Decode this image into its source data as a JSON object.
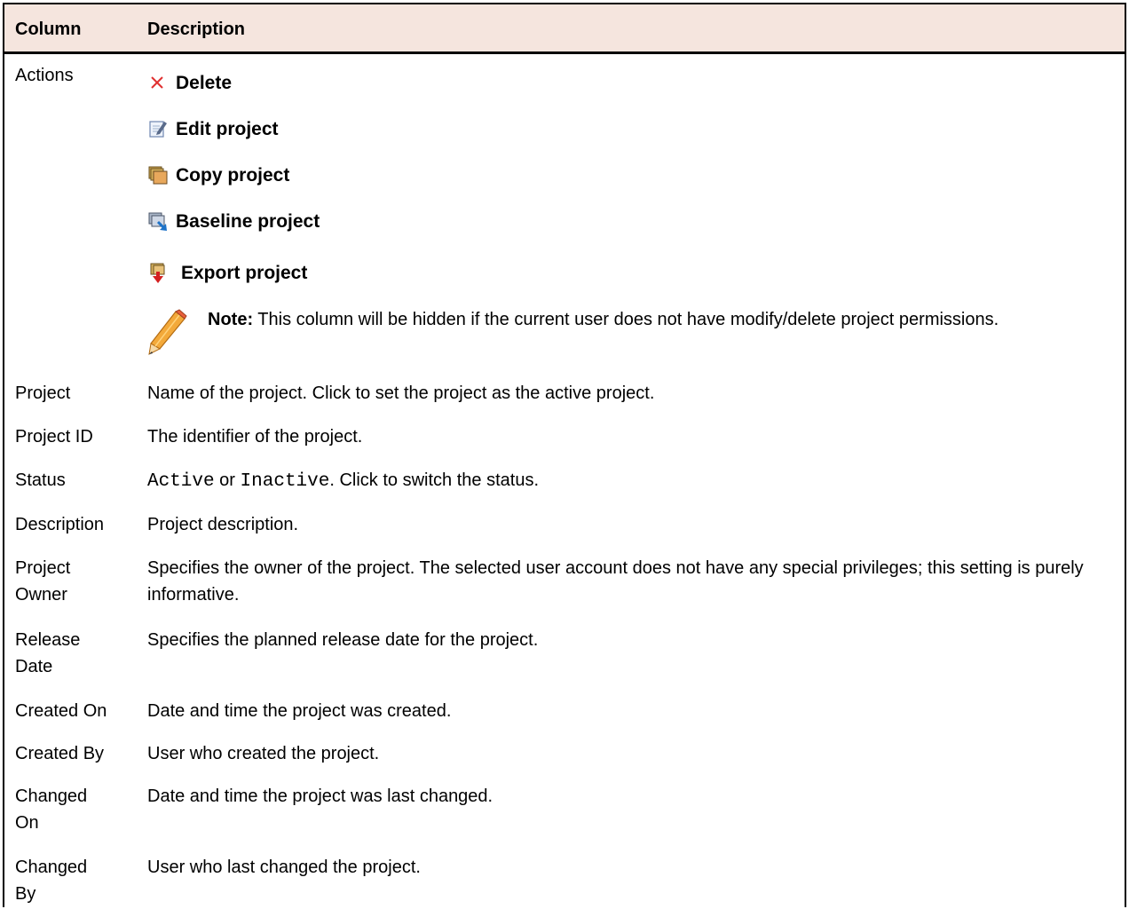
{
  "header": {
    "column": "Column",
    "description": "Description"
  },
  "actions_row": {
    "name": "Actions",
    "items": [
      {
        "label": "Delete",
        "icon": "delete-x-icon",
        "color": "#e03030"
      },
      {
        "label": "Edit project",
        "icon": "edit-document-icon"
      },
      {
        "label": "Copy project",
        "icon": "copy-stack-icon"
      },
      {
        "label": "Baseline project",
        "icon": "baseline-arrow-icon"
      },
      {
        "label": "Export project",
        "icon": "export-down-arrow-icon"
      }
    ],
    "note_label": "Note:",
    "note_text": " This column will be hidden if the current user does not have modify/delete project permissions."
  },
  "rows": [
    {
      "name": "Project",
      "desc": "Name of the project. Click to set the project as the active project."
    },
    {
      "name": "Project ID",
      "desc": "The identifier of the project."
    },
    {
      "name": "Status",
      "desc_mono_1": "Active",
      "desc_or": " or ",
      "desc_mono_2": "Inactive",
      "desc_tail": ". Click to switch the status."
    },
    {
      "name": "Description",
      "desc": "Project description."
    },
    {
      "name_line1": "Project",
      "name_line2": "Owner",
      "desc": "Specifies the owner of the project. The selected user account does not have any special privileges; this setting is purely informative."
    },
    {
      "name_line1": "Release",
      "name_line2": "Date",
      "desc": "Specifies the planned release date for the project."
    },
    {
      "name": "Created On",
      "desc": "Date and time the project was created."
    },
    {
      "name": "Created By",
      "desc": "User who created the project."
    },
    {
      "name_line1": "Changed",
      "name_line2": "On",
      "desc": "Date and time the project was last changed."
    },
    {
      "name_line1": "Changed",
      "name_line2": "By",
      "desc": "User who last changed the project."
    }
  ],
  "colors": {
    "header_bg": "#f5e5de",
    "delete_red": "#e03030"
  }
}
